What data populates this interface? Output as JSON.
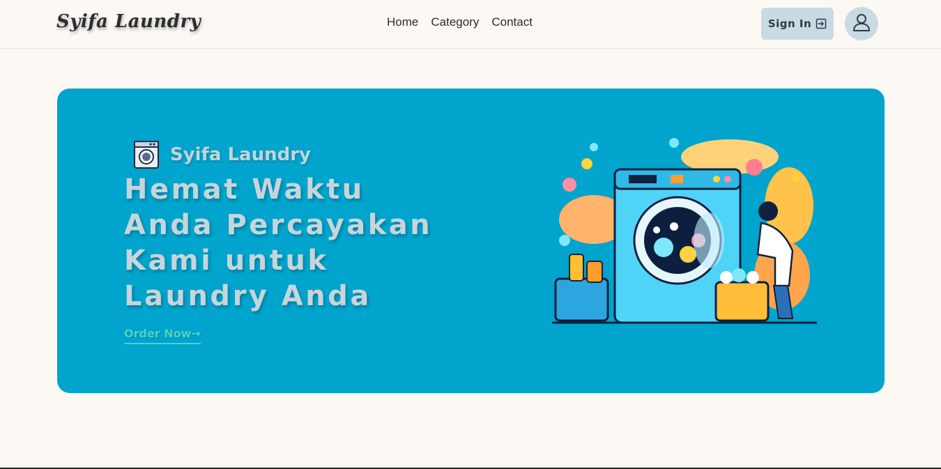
{
  "navbar": {
    "brand": "Syifa Laundry",
    "links": [
      {
        "label": "Home"
      },
      {
        "label": "Category"
      },
      {
        "label": "Contact"
      }
    ],
    "signin_label": "Sign In",
    "signin_icon": "login-arrow-icon",
    "avatar_icon": "user-icon"
  },
  "hero": {
    "brand": "Syifa Laundry",
    "brand_icon": "washing-machine-icon",
    "title_lines": [
      "Hemat Waktu",
      "Anda Percayakan",
      "Kami untuk",
      "Laundry Anda"
    ],
    "cta_label": "Order Now→",
    "background_color": "#00a4cc",
    "illustration": "laundry-illustration"
  }
}
